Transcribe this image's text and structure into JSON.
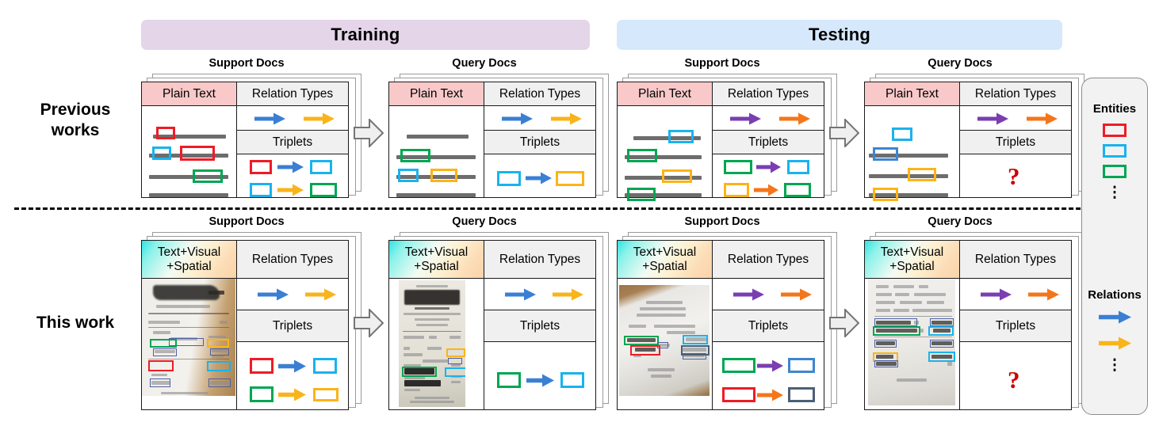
{
  "figure": {
    "phases": [
      {
        "id": "training",
        "label": "Training",
        "color": "#e4d5e9"
      },
      {
        "id": "testing",
        "label": "Testing",
        "color": "#d6e8fb"
      }
    ],
    "rows": [
      {
        "id": "previous",
        "label": "Previous\nworks",
        "label_line1": "Previous",
        "label_line2": "works"
      },
      {
        "id": "this",
        "label": "This work",
        "label_line1": "This work",
        "label_line2": ""
      }
    ],
    "deck_captions": {
      "support": "Support Docs",
      "query": "Query Docs"
    },
    "column_headers": {
      "plain_text": "Plain Text",
      "modality_line1": "Text+Visual",
      "modality_line2": "+Spatial",
      "relation_types": "Relation Types",
      "triplets": "Triplets"
    },
    "unknown_marker": "?"
  },
  "colors": {
    "red": "#ee1c25",
    "cyan": "#19b3ee",
    "green": "#00a651",
    "yellow": "#fbb418",
    "blue_arrow": "#3b7fd4",
    "yellow_arrow": "#f9b41b",
    "purple_arrow": "#7a3eb1",
    "orange_arrow": "#f4761b",
    "steel": "#4b6076",
    "mid_blue": "#3d86d0",
    "text_line_gray": "#6d6d6d",
    "qmark_red": "#cc0000",
    "banner_training": "#e4d5e9",
    "banner_testing": "#d6e8fb",
    "header_pink": "#f9c9c9",
    "header_gray": "#f0f0f0",
    "legend_bg": "#f2f2f2"
  },
  "panels": {
    "prev_training_support": {
      "doc_entities": [
        "red",
        "cyan",
        "red",
        "green"
      ],
      "relation_types": [
        "blue_arrow",
        "yellow_arrow"
      ],
      "triplets": [
        {
          "head": "red",
          "relation": "blue_arrow",
          "tail": "cyan"
        },
        {
          "head": "cyan",
          "relation": "yellow_arrow",
          "tail": "green"
        }
      ]
    },
    "prev_training_query": {
      "doc_entities": [
        "green",
        "cyan",
        "yellow"
      ],
      "relation_types": [
        "blue_arrow",
        "yellow_arrow"
      ],
      "triplets": [
        {
          "head": "cyan",
          "relation": "blue_arrow",
          "tail": "yellow"
        }
      ]
    },
    "prev_testing_support": {
      "doc_entities": [
        "cyan",
        "green",
        "yellow",
        "green"
      ],
      "relation_types": [
        "purple_arrow",
        "orange_arrow"
      ],
      "triplets": [
        {
          "head": "green",
          "relation": "purple_arrow",
          "tail": "cyan"
        },
        {
          "head": "yellow",
          "relation": "orange_arrow",
          "tail": "green"
        }
      ]
    },
    "prev_testing_query": {
      "doc_entities": [
        "cyan",
        "mid_blue",
        "yellow",
        "yellow"
      ],
      "relation_types": [
        "purple_arrow",
        "orange_arrow"
      ],
      "triplets": []
    },
    "this_training_support": {
      "receipt_name": "noodle-receipt-photo",
      "relation_types": [
        "blue_arrow",
        "yellow_arrow"
      ],
      "triplets": [
        {
          "head": "red",
          "relation": "blue_arrow",
          "tail": "cyan"
        },
        {
          "head": "green",
          "relation": "yellow_arrow",
          "tail": "yellow"
        }
      ]
    },
    "this_training_query": {
      "receipt_name": "dynamic-receipt-photo",
      "relation_types": [
        "blue_arrow",
        "yellow_arrow"
      ],
      "triplets": [
        {
          "head": "green",
          "relation": "blue_arrow",
          "tail": "cyan"
        }
      ]
    },
    "this_testing_support": {
      "receipt_name": "crumpled-receipt-photo",
      "relation_types": [
        "purple_arrow",
        "orange_arrow"
      ],
      "triplets": [
        {
          "head": "green",
          "relation": "purple_arrow",
          "tail": "mid_blue"
        },
        {
          "head": "red",
          "relation": "orange_arrow",
          "tail": "steel"
        }
      ]
    },
    "this_testing_query": {
      "receipt_name": "gopay-receipt-photo",
      "relation_types": [
        "purple_arrow",
        "orange_arrow"
      ],
      "triplets": []
    }
  },
  "receipt_text": {
    "noodle": [
      "Total"
    ],
    "dynamic": [
      "Dynamic",
      "TOTAL",
      "CHANGE"
    ],
    "crumpled": [
      "ORI SLHN",
      "CASH",
      "48.000",
      "100.000"
    ],
    "gopay": [
      "ES KOPI SUSU",
      "ES KOPI SOKLAT",
      "108.000",
      "20.000",
      "Total",
      "128.000",
      "GoPay",
      "128.000",
      "Kembali",
      "0"
    ]
  },
  "legend": {
    "entities_title": "Entities",
    "entity_colors": [
      "red",
      "cyan",
      "green"
    ],
    "entities_ellipsis": "⋮",
    "relations_title": "Relations",
    "relation_colors": [
      "blue_arrow",
      "yellow_arrow"
    ],
    "relations_ellipsis": "⋮"
  }
}
